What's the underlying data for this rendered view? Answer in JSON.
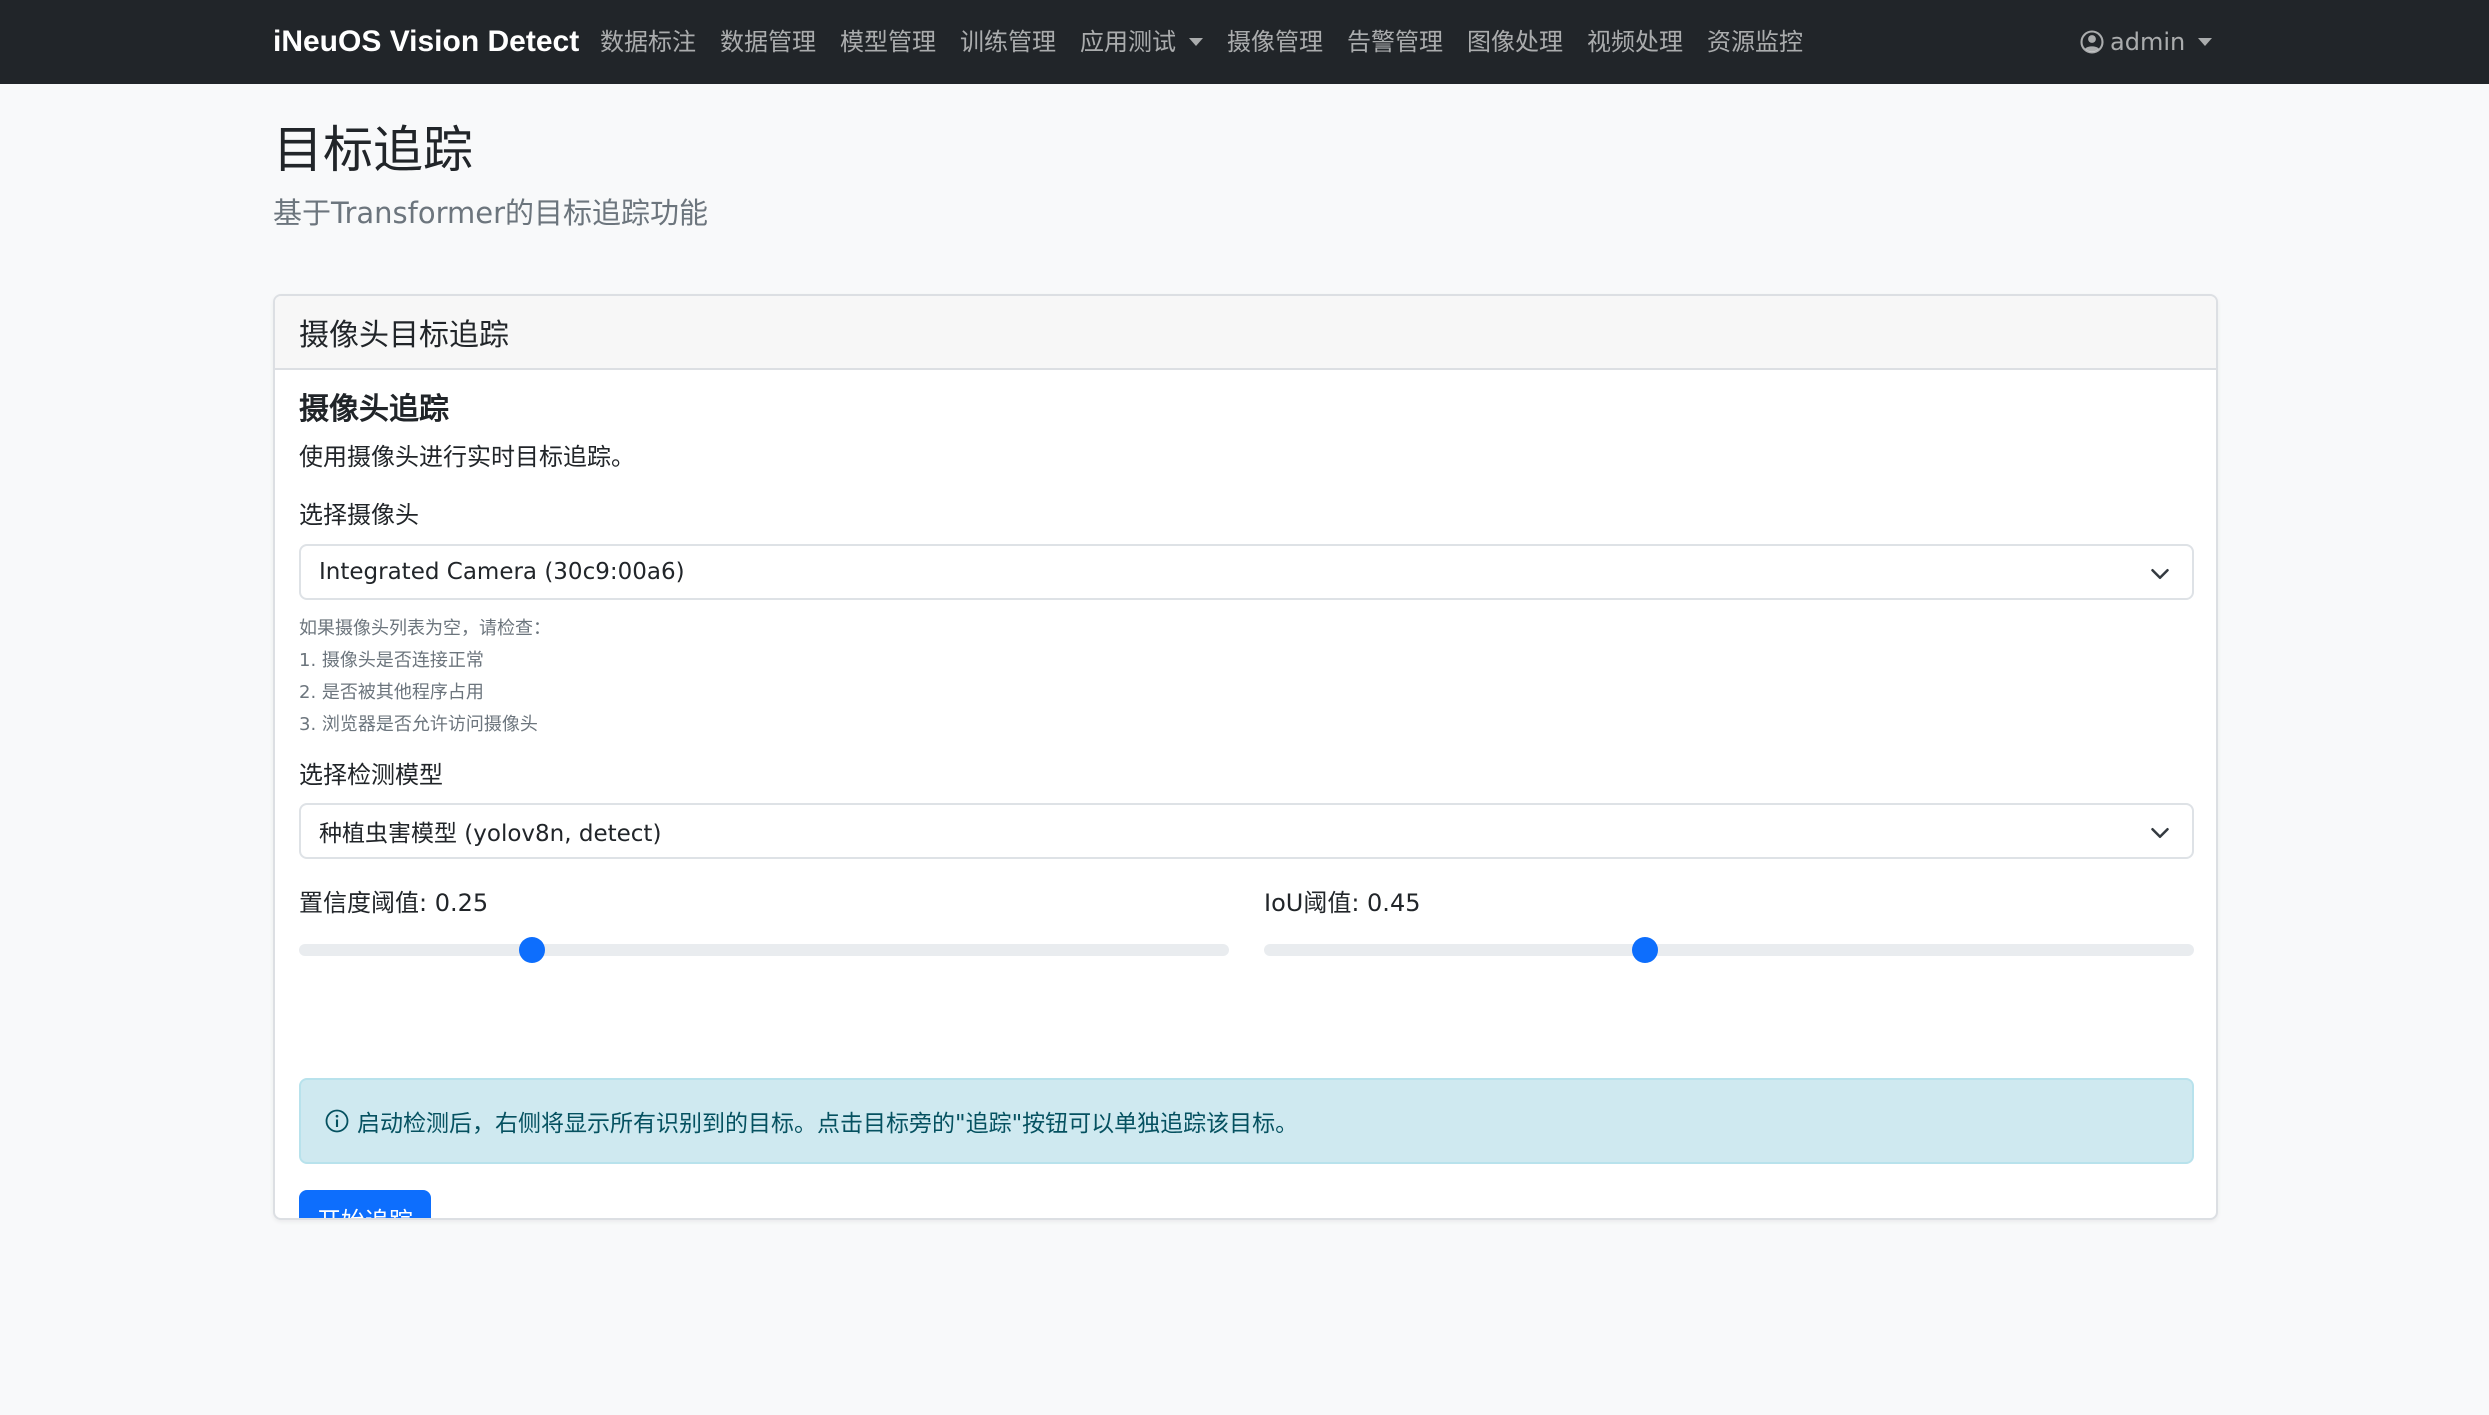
{
  "navbar": {
    "brand": "iNeuOS Vision Detect",
    "items": [
      {
        "label": "数据标注"
      },
      {
        "label": "数据管理"
      },
      {
        "label": "模型管理"
      },
      {
        "label": "训练管理"
      },
      {
        "label": "应用测试"
      },
      {
        "label": "摄像管理"
      },
      {
        "label": "告警管理"
      },
      {
        "label": "图像处理"
      },
      {
        "label": "视频处理"
      },
      {
        "label": "资源监控"
      }
    ],
    "user": "admin"
  },
  "page": {
    "title": "目标追踪",
    "subtitle": "基于Transformer的目标追踪功能"
  },
  "card": {
    "header": "摄像头目标追踪",
    "section_title": "摄像头追踪",
    "section_desc": "使用摄像头进行实时目标追踪。",
    "camera": {
      "label": "选择摄像头",
      "selected": "Integrated Camera (30c9:00a6)",
      "hints": [
        "如果摄像头列表为空，请检查：",
        "1. 摄像头是否连接正常",
        "2. 是否被其他程序占用",
        "3. 浏览器是否允许访问摄像头"
      ]
    },
    "model": {
      "label": "选择检测模型",
      "selected": "种植虫害模型 (yolov8n, detect)"
    },
    "confidence": {
      "label": "置信度阈值: 0.25",
      "value": 0.25
    },
    "iou": {
      "label": "IoU阈值: 0.45",
      "value": 0.45
    },
    "alert": "启动检测后，右侧将显示所有识别到的目标。点击目标旁的\"追踪\"按钮可以单独追踪该目标。",
    "start_button": "开始追踪"
  },
  "colors": {
    "navbar_bg": "#212529",
    "primary": "#0d6efd",
    "alert_bg": "#cfe9f0",
    "alert_text": "#055160"
  }
}
